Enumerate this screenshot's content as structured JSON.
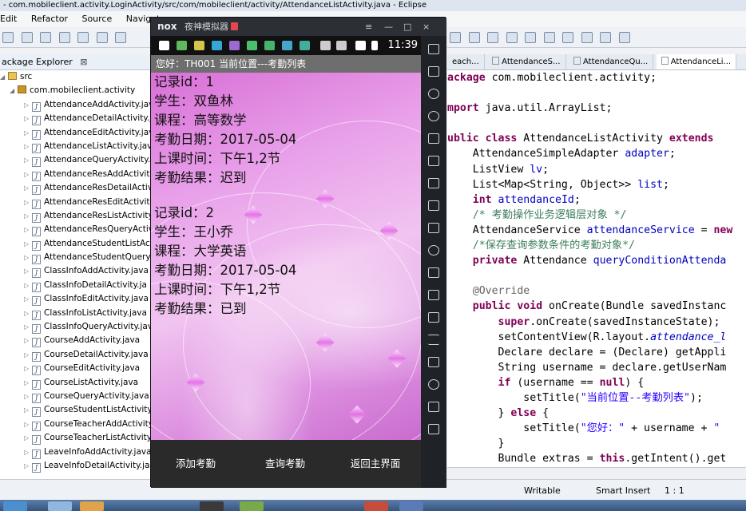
{
  "window_title": "- com.mobileclient.activity.LoginActivity/src/com/mobileclient/activity/AttendanceListActivity.java - Eclipse",
  "menu": [
    "Edit",
    "Refactor",
    "Source",
    "Navigate"
  ],
  "package_explorer": {
    "tab_label": "ackage Explorer",
    "tab_close": "⊠",
    "src_label": "src",
    "package_label": "com.mobileclient.activity",
    "files": [
      "AttendanceAddActivity.java",
      "AttendanceDetailActivity.ja",
      "AttendanceEditActivity.java",
      "AttendanceListActivity.java",
      "AttendanceQueryActivity.ja",
      "AttendanceResAddActivity",
      "AttendanceResDetailActivi",
      "AttendanceResEditActivity",
      "AttendanceResListActivity.",
      "AttendanceResQueryActiv",
      "AttendanceStudentListActi",
      "AttendanceStudentQuery/",
      "ClassInfoAddActivity.java",
      "ClassInfoDetailActivity.ja",
      "ClassInfoEditActivity.java",
      "ClassInfoListActivity.java",
      "ClassInfoQueryActivity.jav",
      "CourseAddActivity.java",
      "CourseDetailActivity.java",
      "CourseEditActivity.java",
      "CourseListActivity.java",
      "CourseQueryActivity.java",
      "CourseStudentListActivity.",
      "CourseTeacherAddActivity",
      "CourseTeacherListActivity.",
      "LeaveInfoAddActivity.java",
      "LeaveInfoDetailActivity.jav"
    ]
  },
  "editor_tabs": [
    "each...",
    "AttendanceS...",
    "AttendanceQu...",
    "AttendanceLi..."
  ],
  "code_lines": [
    [
      [
        "kw",
        "ackage"
      ],
      [
        "t",
        " com.mobileclient.activity;"
      ]
    ],
    [
      [
        "t",
        ""
      ]
    ],
    [
      [
        "kw",
        "mport"
      ],
      [
        "t",
        " java.util.ArrayList;"
      ]
    ],
    [
      [
        "t",
        ""
      ]
    ],
    [
      [
        "kw",
        "ublic class"
      ],
      [
        "t",
        " AttendanceListActivity "
      ],
      [
        "kw",
        "extends"
      ]
    ],
    [
      [
        "t",
        "    AttendanceSimpleAdapter "
      ],
      [
        "fd",
        "adapter"
      ],
      [
        "t",
        ";"
      ]
    ],
    [
      [
        "t",
        "    ListView "
      ],
      [
        "fd",
        "lv"
      ],
      [
        "t",
        ";"
      ]
    ],
    [
      [
        "t",
        "    List<Map<String, Object>> "
      ],
      [
        "fd",
        "list"
      ],
      [
        "t",
        ";"
      ]
    ],
    [
      [
        "t",
        "    "
      ],
      [
        "kw",
        "int"
      ],
      [
        "t",
        " "
      ],
      [
        "fd",
        "attendanceId"
      ],
      [
        "t",
        ";"
      ]
    ],
    [
      [
        "t",
        "    "
      ],
      [
        "cm",
        "/* 考勤操作业务逻辑层对象 */"
      ]
    ],
    [
      [
        "t",
        "    AttendanceService "
      ],
      [
        "fd",
        "attendanceService"
      ],
      [
        "t",
        " = "
      ],
      [
        "kw",
        "new"
      ]
    ],
    [
      [
        "t",
        "    "
      ],
      [
        "cm",
        "/*保存查询参数条件的考勤对象*/"
      ]
    ],
    [
      [
        "t",
        "    "
      ],
      [
        "kw",
        "private"
      ],
      [
        "t",
        " Attendance "
      ],
      [
        "fd",
        "queryConditionAttenda"
      ]
    ],
    [
      [
        "t",
        ""
      ]
    ],
    [
      [
        "t",
        "    "
      ],
      [
        "an",
        "@Override"
      ]
    ],
    [
      [
        "t",
        "    "
      ],
      [
        "kw",
        "public void"
      ],
      [
        "t",
        " onCreate(Bundle savedInstanc"
      ]
    ],
    [
      [
        "t",
        "        "
      ],
      [
        "kw",
        "super"
      ],
      [
        "t",
        ".onCreate(savedInstanceState);"
      ]
    ],
    [
      [
        "t",
        "        setContentView(R.layout."
      ],
      [
        "it",
        "attendance_l"
      ]
    ],
    [
      [
        "t",
        "        Declare declare = (Declare) getAppli"
      ]
    ],
    [
      [
        "t",
        "        String username = declare.getUserNam"
      ]
    ],
    [
      [
        "t",
        "        "
      ],
      [
        "kw",
        "if"
      ],
      [
        "t",
        " (username == "
      ],
      [
        "kw",
        "null"
      ],
      [
        "t",
        ") {"
      ]
    ],
    [
      [
        "t",
        "            setTitle("
      ],
      [
        "st",
        "\"当前位置--考勤列表\""
      ],
      [
        "t",
        ");"
      ]
    ],
    [
      [
        "t",
        "        } "
      ],
      [
        "kw",
        "else"
      ],
      [
        "t",
        " {"
      ]
    ],
    [
      [
        "t",
        "            setTitle("
      ],
      [
        "st",
        "\"您好：\""
      ],
      [
        "t",
        " + username + "
      ],
      [
        "st",
        "\""
      ]
    ],
    [
      [
        "t",
        "        }"
      ]
    ],
    [
      [
        "t",
        "        Bundle extras = "
      ],
      [
        "kw",
        "this"
      ],
      [
        "t",
        ".getIntent().get"
      ]
    ]
  ],
  "status_bar": {
    "writable": "Writable",
    "insert_mode": "Smart Insert",
    "position": "1 : 1"
  },
  "emulator": {
    "logo": "nox",
    "name": "夜神模拟器",
    "controls": [
      "≡",
      "—",
      "□",
      "×"
    ],
    "clock": "11:39"
  },
  "app": {
    "title": "您好：TH001  当前位置---考勤列表",
    "records": [
      {
        "id_line": "记录id：1",
        "student_line": "学生：双鱼林",
        "course_line": "课程：高等数学",
        "date_line": "考勤日期：2017-05-04",
        "time_line": "上课时间：下午1,2节",
        "result_line": "考勤结果：迟到"
      },
      {
        "id_line": "记录id：2",
        "student_line": "学生：王小乔",
        "course_line": "课程：大学英语",
        "date_line": "考勤日期：2017-05-04",
        "time_line": "上课时间：下午1,2节",
        "result_line": "考勤结果：已到"
      }
    ],
    "buttons": {
      "add": "添加考勤",
      "query": "查询考勤",
      "back": "返回主界面"
    }
  },
  "colors": {
    "keyword": "#7f0055",
    "comment": "#3f7f5f",
    "string": "#2a00ff",
    "field": "#0000c0",
    "app_background": "#e9a2ea"
  }
}
